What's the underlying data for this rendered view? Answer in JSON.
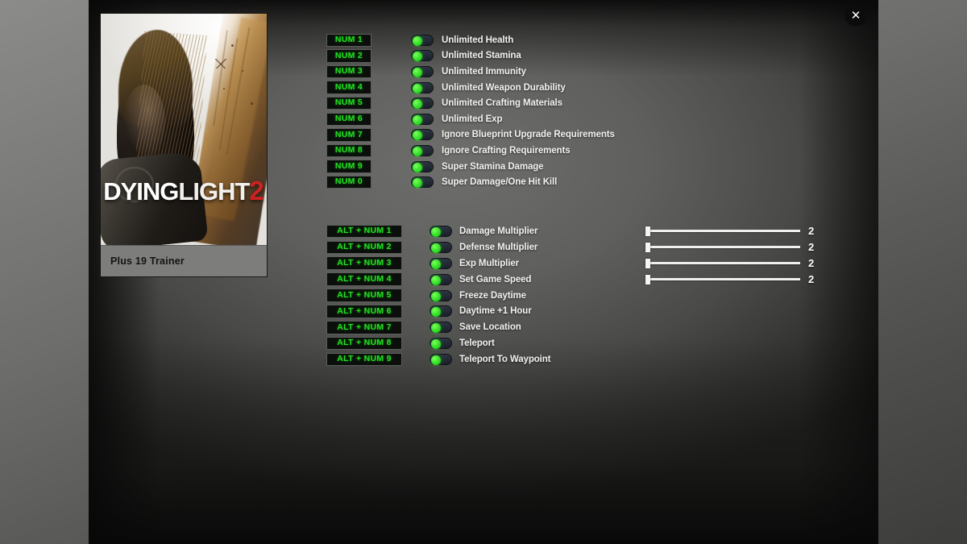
{
  "window": {
    "close_label": "✕"
  },
  "cover": {
    "game_title_part1": "DYING",
    "game_title_part2": "LIGHT",
    "game_title_number": "2",
    "caption": "Plus 19 Trainer"
  },
  "sections": [
    {
      "id": "primary",
      "rows": [
        {
          "hotkey": "NUM 1",
          "label": "Unlimited Health",
          "toggle": "on"
        },
        {
          "hotkey": "NUM 2",
          "label": "Unlimited Stamina",
          "toggle": "on"
        },
        {
          "hotkey": "NUM 3",
          "label": "Unlimited Immunity",
          "toggle": "on"
        },
        {
          "hotkey": "NUM 4",
          "label": "Unlimited Weapon Durability",
          "toggle": "on"
        },
        {
          "hotkey": "NUM 5",
          "label": "Unlimited Crafting Materials",
          "toggle": "on"
        },
        {
          "hotkey": "NUM 6",
          "label": "Unlimited Exp",
          "toggle": "on"
        },
        {
          "hotkey": "NUM 7",
          "label": "Ignore Blueprint Upgrade Requirements",
          "toggle": "on"
        },
        {
          "hotkey": "NUM 8",
          "label": "Ignore Crafting Requirements",
          "toggle": "on"
        },
        {
          "hotkey": "NUM 9",
          "label": "Super Stamina Damage",
          "toggle": "on"
        },
        {
          "hotkey": "NUM 0",
          "label": "Super Damage/One Hit Kill",
          "toggle": "on"
        }
      ]
    },
    {
      "id": "secondary",
      "rows": [
        {
          "hotkey": "ALT + NUM 1",
          "label": "Damage Multiplier",
          "toggle": "on",
          "slider": {
            "value": "2",
            "position_pct": 0
          }
        },
        {
          "hotkey": "ALT + NUM 2",
          "label": "Defense Multiplier",
          "toggle": "on",
          "slider": {
            "value": "2",
            "position_pct": 0
          }
        },
        {
          "hotkey": "ALT + NUM 3",
          "label": "Exp Multiplier",
          "toggle": "on",
          "slider": {
            "value": "2",
            "position_pct": 0
          }
        },
        {
          "hotkey": "ALT + NUM 4",
          "label": "Set Game Speed",
          "toggle": "on",
          "slider": {
            "value": "2",
            "position_pct": 0
          }
        },
        {
          "hotkey": "ALT + NUM 5",
          "label": "Freeze Daytime",
          "toggle": "on"
        },
        {
          "hotkey": "ALT + NUM 6",
          "label": "Daytime +1 Hour",
          "toggle": "on"
        },
        {
          "hotkey": "ALT + NUM 7",
          "label": "Save Location",
          "toggle": "on"
        },
        {
          "hotkey": "ALT + NUM 8",
          "label": "Teleport",
          "toggle": "on"
        },
        {
          "hotkey": "ALT + NUM 9",
          "label": "Teleport To Waypoint",
          "toggle": "on"
        }
      ]
    }
  ],
  "colors": {
    "hotkey_text": "#22e022",
    "hotkey_bg": "#0b0f0b",
    "toggle_knob": "#35e02a",
    "label_text": "#f2f2f2",
    "caption_bg": "#7d7d7b",
    "title_accent": "#cc2222"
  }
}
